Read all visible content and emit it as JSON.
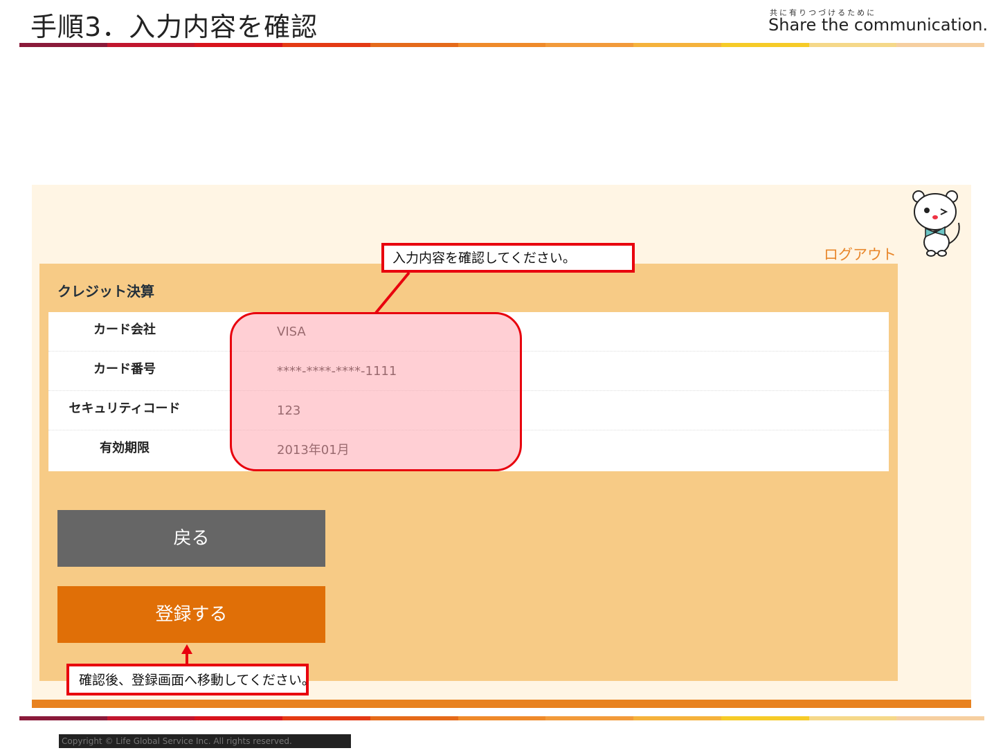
{
  "slide": {
    "title": "手順3．入力内容を確認",
    "tagline": "共に有りつづけるために",
    "brand": "Share the communication."
  },
  "stripe_colors": [
    "#8a1a3a",
    "#c1162e",
    "#d8141c",
    "#e43a14",
    "#e56a1a",
    "#ef8a2a",
    "#f29a3a",
    "#f5b23c",
    "#f6cb28",
    "#f5d889",
    "#f6cfa0"
  ],
  "app": {
    "logout_label": "ログアウト",
    "panel_title": "クレジット決算",
    "rows": [
      {
        "label": "カード会社",
        "value": "VISA"
      },
      {
        "label": "カード番号",
        "value": "****-****-****-1111"
      },
      {
        "label": "セキュリティコード",
        "value": "123"
      },
      {
        "label": "有効期限",
        "value": "2013年01月"
      }
    ],
    "back_button": "戻る",
    "register_button": "登録する"
  },
  "annotations": {
    "top_callout": "入力内容を確認してください。",
    "bottom_callout": "確認後、登録画面へ移動してください。"
  },
  "colors": {
    "panel": "#f7cb86",
    "frame": "#fff5e4",
    "back_button": "#666666",
    "register_button": "#e06f07",
    "callout_border": "#e8000d",
    "logout": "#e8862a"
  },
  "footer": {
    "copyright": "Copyright © Life Global Service Inc. All rights reserved."
  }
}
